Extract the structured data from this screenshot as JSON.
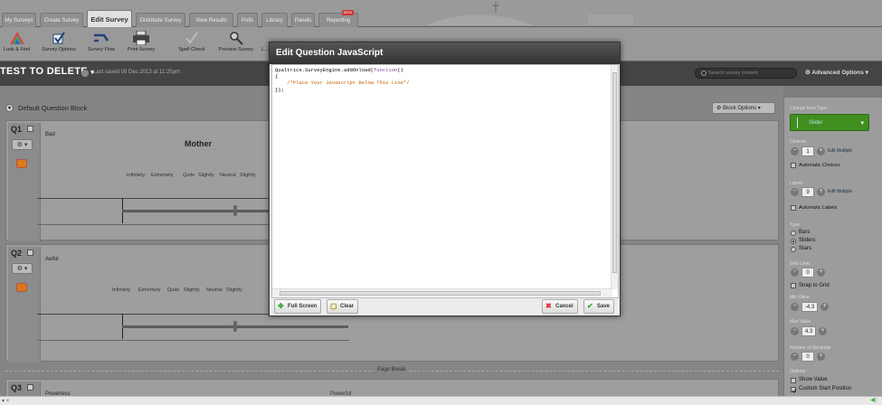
{
  "tabs": [
    {
      "label": "My Surveys"
    },
    {
      "label": "Create Survey"
    },
    {
      "label": "Edit Survey"
    },
    {
      "label": "Distribute Survey"
    },
    {
      "label": "View Results"
    },
    {
      "label": "Polls"
    },
    {
      "label": "Library"
    },
    {
      "label": "Panels"
    },
    {
      "label": "Reporting",
      "badge": "NEW"
    }
  ],
  "toolbar": [
    {
      "label": "Look & Feel",
      "icon": "look-feel-icon"
    },
    {
      "label": "Survey Options",
      "icon": "checkbox-icon"
    },
    {
      "label": "Survey Flow",
      "icon": "flow-arrows-icon"
    },
    {
      "label": "Print Survey",
      "icon": "printer-icon"
    },
    {
      "label": "Spell Check",
      "icon": "checkmark-icon"
    },
    {
      "label": "Preview Survey",
      "icon": "magnifier-icon"
    },
    {
      "label": "L...",
      "icon": "globe-icon"
    }
  ],
  "survey": {
    "title": "TEST TO DELETE",
    "last_saved": "Last saved 09 Dec 2013 at 11:25pm",
    "search_placeholder": "Search survey content",
    "advanced_options": "Advanced Options"
  },
  "block": {
    "name": "Default Question Block",
    "options_label": "Block Options"
  },
  "questions": [
    {
      "id": "Q1",
      "text": "Bad",
      "statement": "Mother",
      "scale": [
        "Infinitely",
        "Extremely",
        "Quite",
        "Slightly",
        "Neutral",
        "Slightly"
      ]
    },
    {
      "id": "Q2",
      "text": "Awful",
      "scale": [
        "Infinitely",
        "Extremely",
        "Quite",
        "Slightly",
        "Neutral",
        "Slightly"
      ]
    },
    {
      "id": "Q3",
      "text": "Powerless",
      "right_text": "Powerful"
    }
  ],
  "page_break": "Page Break",
  "modal": {
    "title": "Edit Question JavaScript",
    "code_line1_a": "Qualtrics.SurveyEngine.addOnload(",
    "code_line1_kw": "function",
    "code_line1_b": "()",
    "code_line2": "{",
    "code_line3": "    /*Place Your Javascript Below This Line*/",
    "code_line4": "});",
    "full_screen": "Full Screen",
    "clear": "Clear",
    "cancel": "Cancel",
    "save": "Save"
  },
  "panel": {
    "change_item_type": "Change Item Type",
    "type_value": "Slider",
    "choices_label": "Choices",
    "choices_value": "1",
    "edit_multiple": "Edit Multiple",
    "automatic_choices": "Automatic Choices",
    "labels_label": "Labels",
    "labels_value": "9",
    "automatic_labels": "Automatic Labels",
    "type_label": "Type",
    "type_options": [
      "Bars",
      "Sliders",
      "Stars"
    ],
    "grid_lines_label": "Grid Lines",
    "grid_lines_value": "0",
    "snap_to_grid": "Snap to Grid",
    "min_value_label": "Min Value",
    "min_value": "-4.3",
    "max_value_label": "Max Value",
    "max_value": "4.3",
    "decimals_label": "Number of Decimals",
    "decimals_value": "0",
    "options_label": "Options",
    "show_value": "Show Value",
    "custom_start": "Custom Start Position"
  },
  "colors": {
    "accent_green": "#3f8f1f",
    "orange": "#d97a1a",
    "modal_header": "#3a3a3a"
  }
}
